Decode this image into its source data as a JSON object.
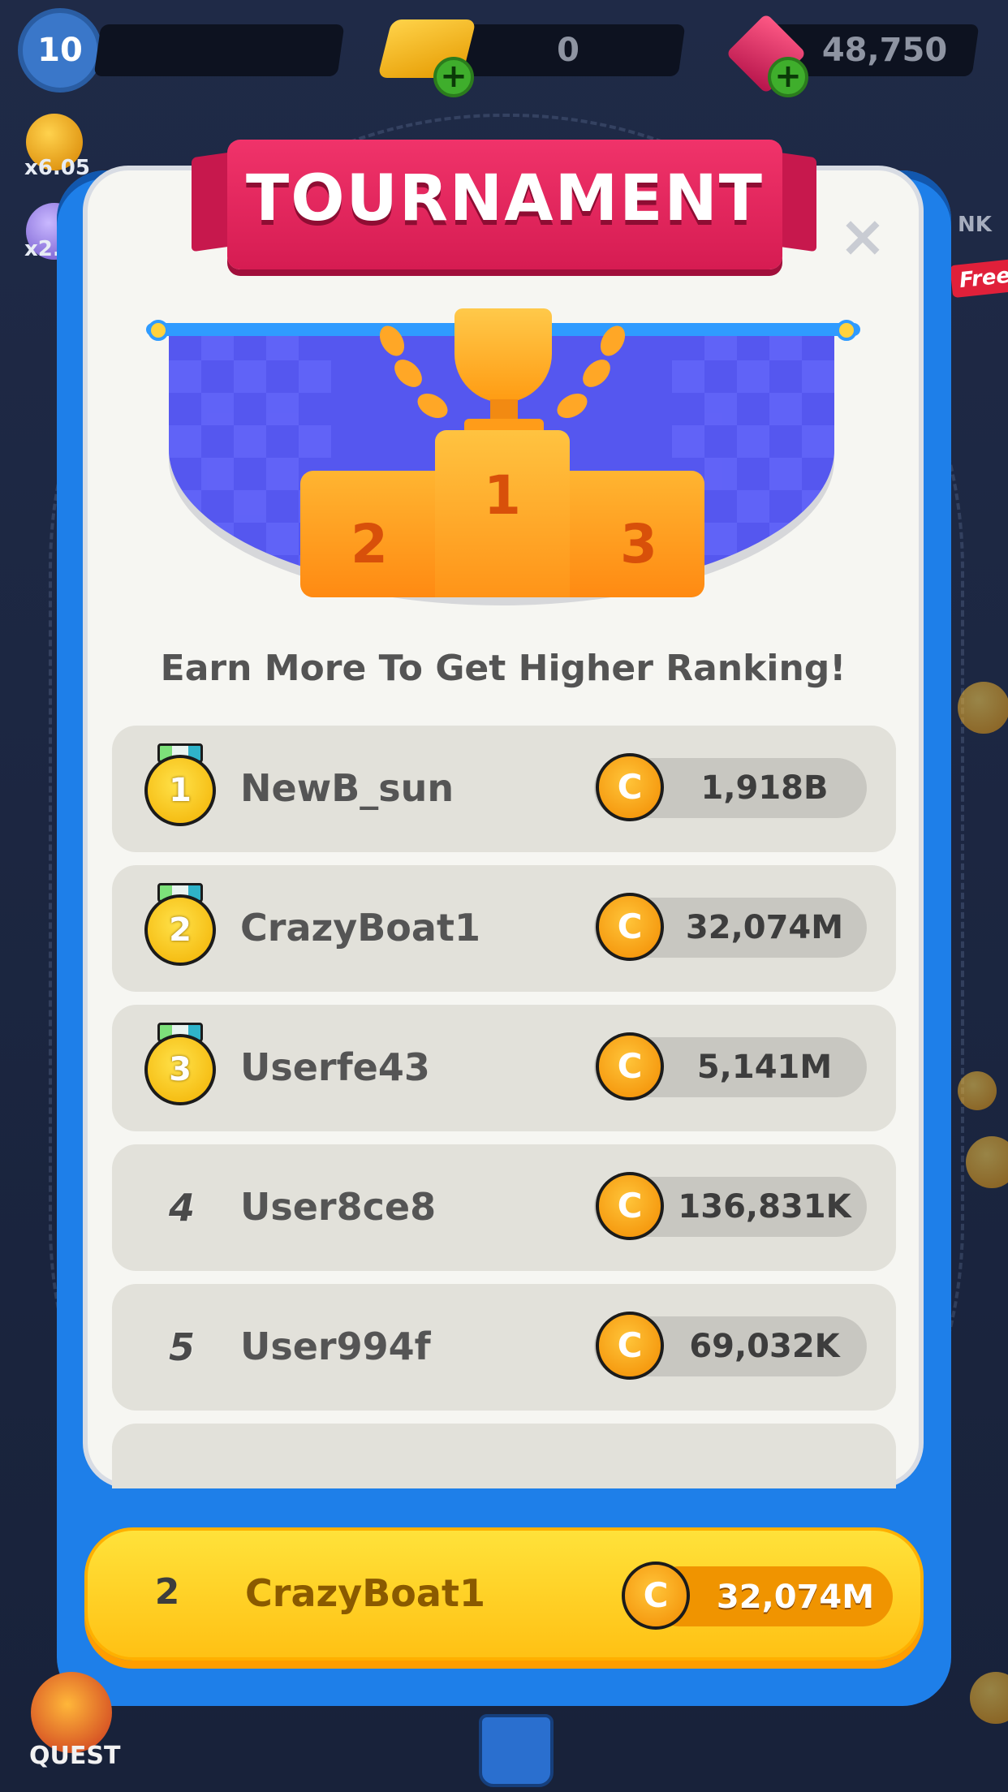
{
  "topbar": {
    "level": "10",
    "gold": "0",
    "gems": "48,750",
    "side_multiplier_1": "x6.05",
    "side_multiplier_2": "x2.",
    "rank_label": "NK",
    "free_tag": "Free"
  },
  "modal": {
    "title": "TOURNAMENT",
    "close_symbol": "×",
    "podium": [
      "1",
      "2",
      "3"
    ],
    "subtitle": "Earn More To Get Higher Ranking!"
  },
  "leaderboard": [
    {
      "rank": "1",
      "name": "NewB_sun",
      "score": "1,918B",
      "medal": true
    },
    {
      "rank": "2",
      "name": "CrazyBoat1",
      "score": "32,074M",
      "medal": true
    },
    {
      "rank": "3",
      "name": "Userfe43",
      "score": "5,141M",
      "medal": true
    },
    {
      "rank": "4",
      "name": "User8ce8",
      "score": "136,831K",
      "medal": false
    },
    {
      "rank": "5",
      "name": "User994f",
      "score": "69,032K",
      "medal": false
    }
  ],
  "current_user": {
    "rank": "2",
    "name": "CrazyBoat1",
    "score": "32,074M"
  },
  "bottom": {
    "quest_label": "QUEST"
  },
  "icons": {
    "coin": "coin-icon",
    "close": "close-icon",
    "trophy": "trophy-icon",
    "medal": "medal-icon"
  },
  "colors": {
    "panel_blue": "#1e7fe9",
    "ribbon_pink": "#e8275e",
    "user_yellow": "#ffd21e"
  }
}
